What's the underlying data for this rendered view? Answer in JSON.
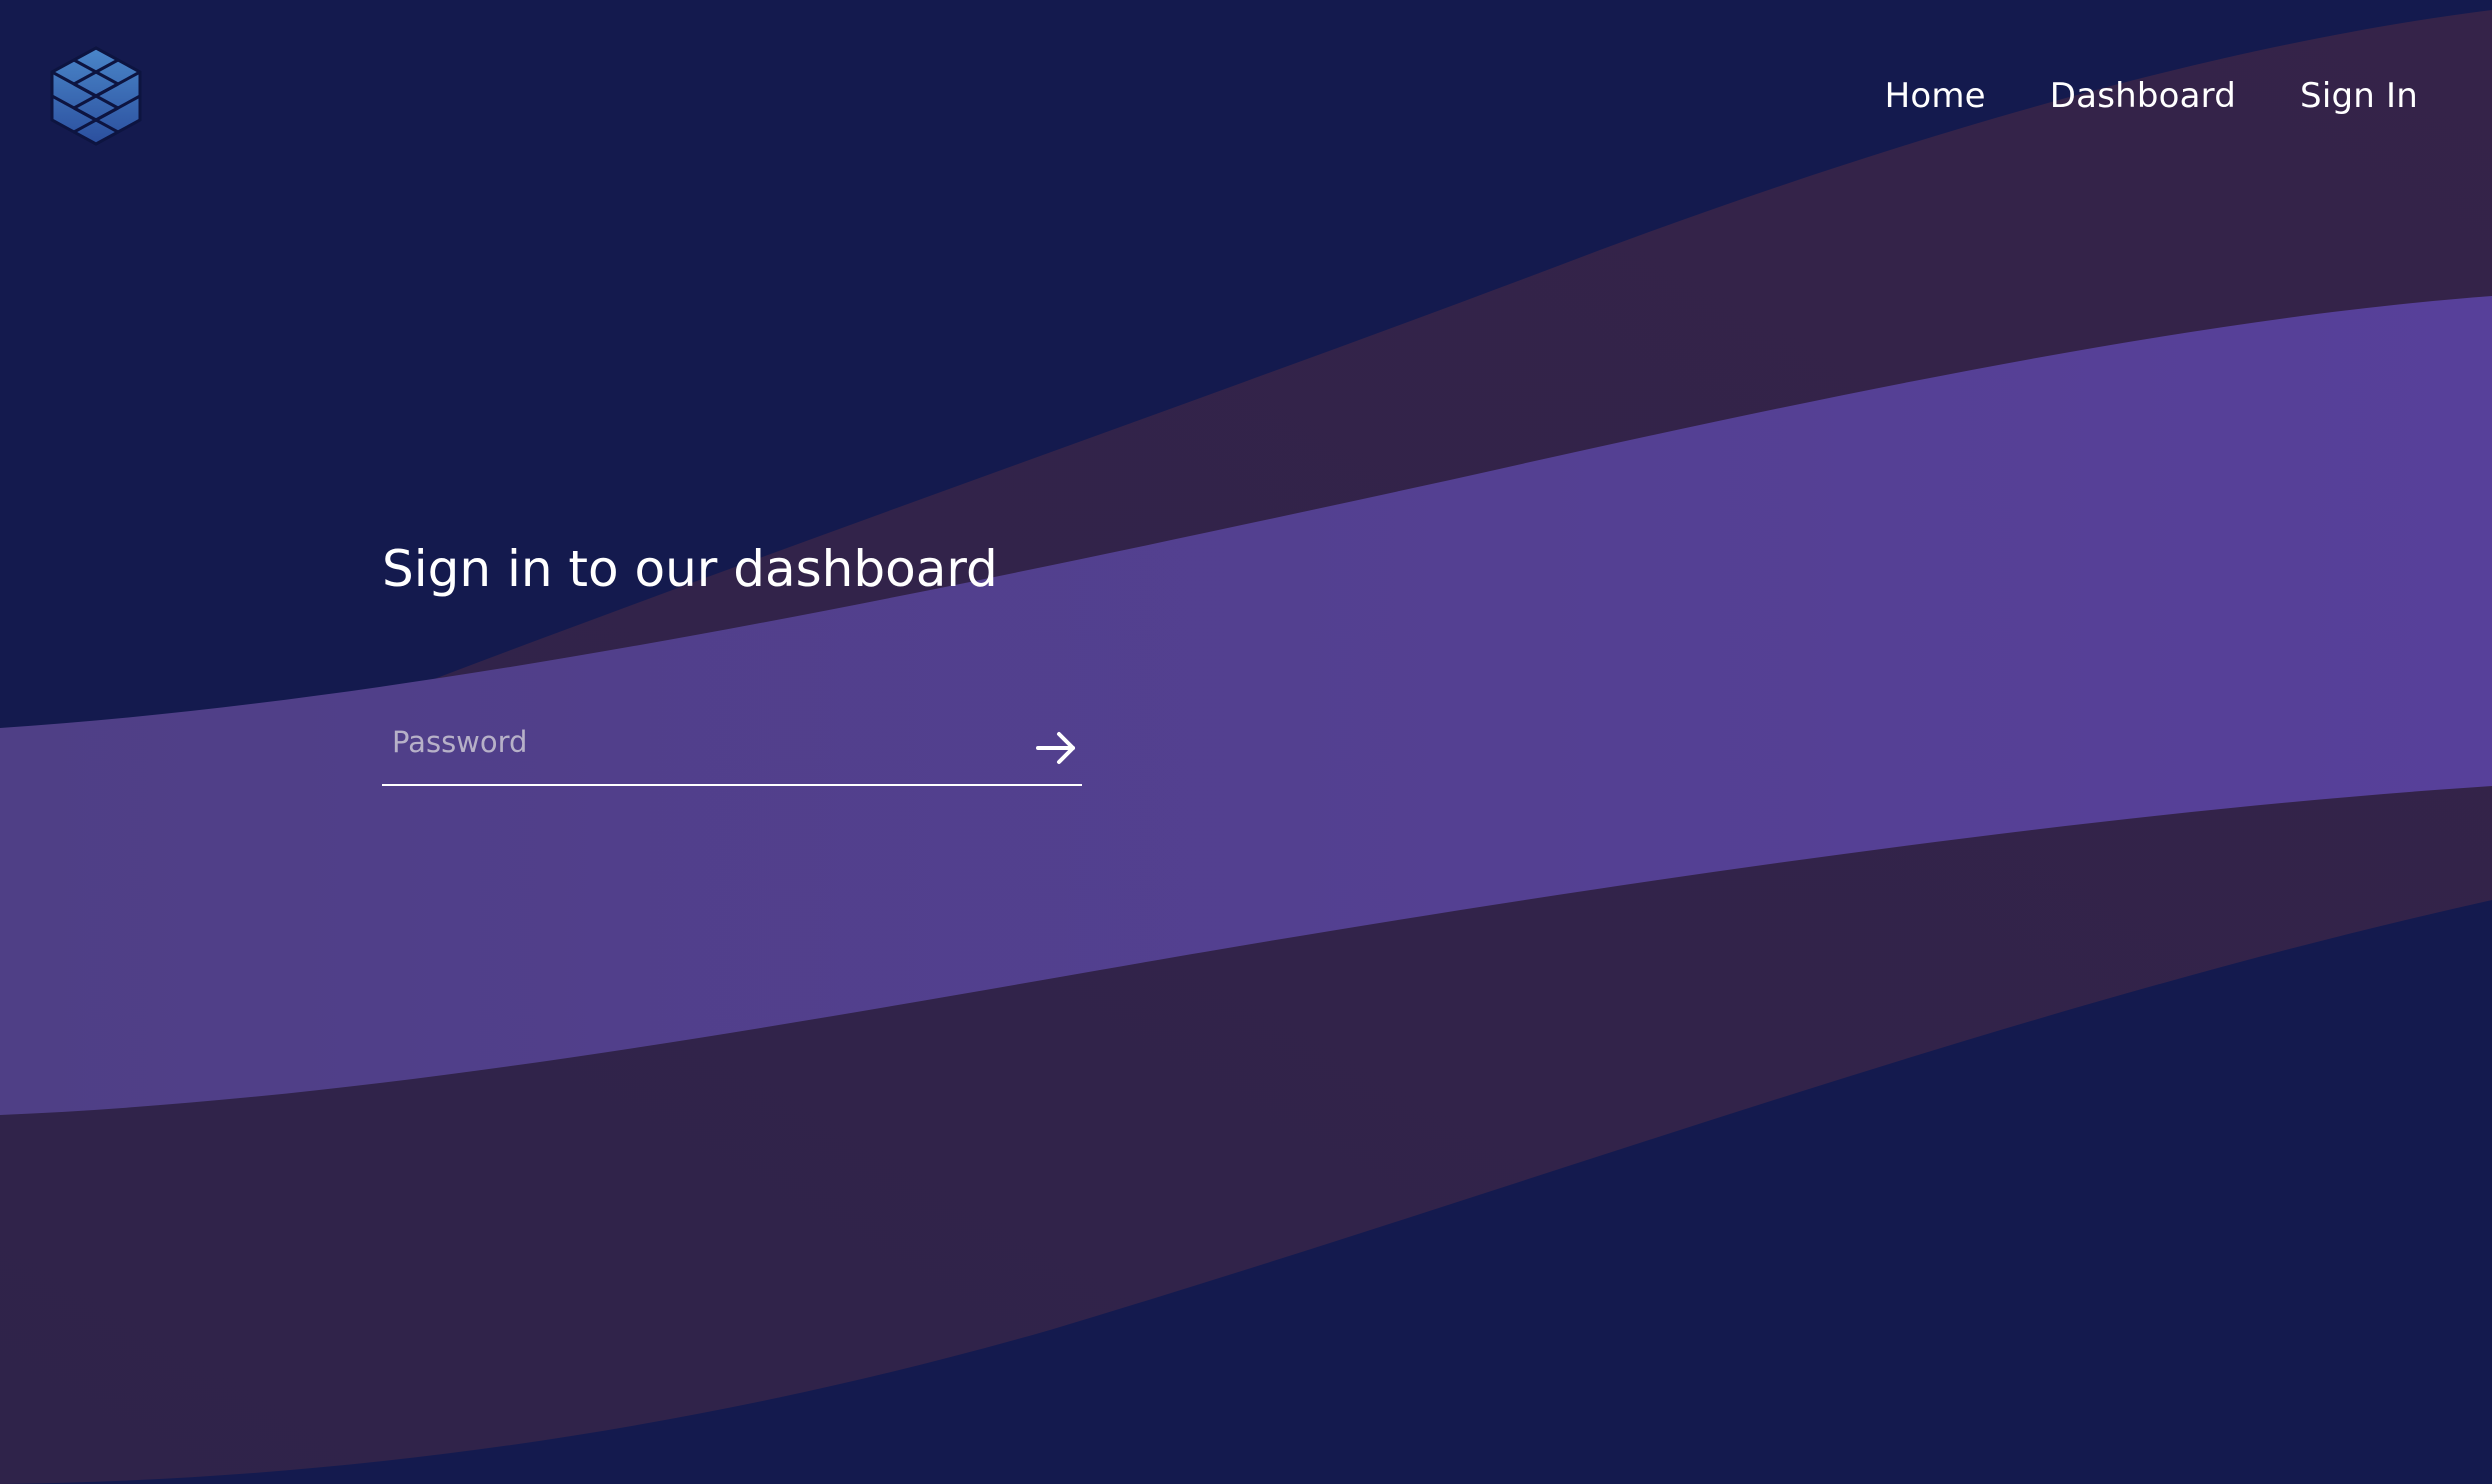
{
  "nav": {
    "home": "Home",
    "dashboard": "Dashboard",
    "sign_in": "Sign In"
  },
  "login": {
    "heading": "Sign in to our dashboard",
    "password_placeholder": "Password",
    "password_value": "",
    "submit_icon": "arrow-right-icon"
  },
  "brand": {
    "logo_icon": "stacked-cube-logo-icon"
  },
  "colors": {
    "background": "#141a4e",
    "wave_dark": "#342348",
    "wave_purple": "#55418f",
    "text": "#ffffff",
    "placeholder": "#b7b1c8",
    "logo_light": "#4a86c9",
    "logo_dark": "#2b4f9e"
  }
}
